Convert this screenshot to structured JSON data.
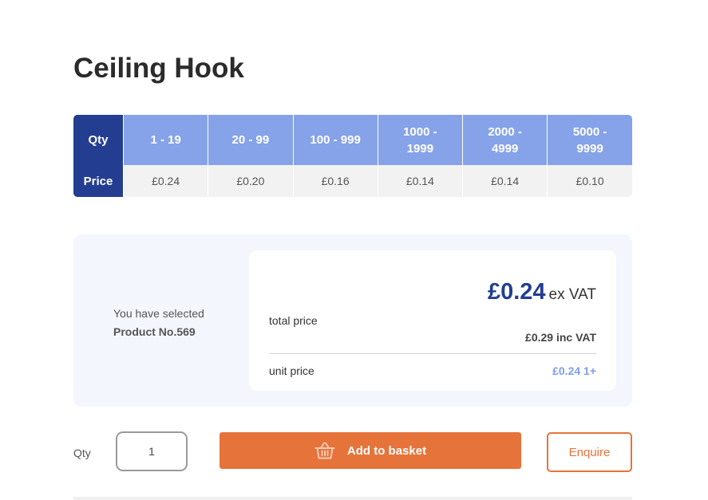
{
  "product": {
    "title": "Ceiling Hook"
  },
  "pricing_table": {
    "qty_header": "Qty",
    "price_header": "Price",
    "tiers": [
      {
        "qty": "1 - 19",
        "price": "£0.24"
      },
      {
        "qty": "20 - 99",
        "price": "£0.20"
      },
      {
        "qty": "100 - 999",
        "price": "£0.16"
      },
      {
        "qty": "1000 - 1999",
        "price": "£0.14"
      },
      {
        "qty": "2000 - 4999",
        "price": "£0.14"
      },
      {
        "qty": "5000 - 9999",
        "price": "£0.10"
      }
    ]
  },
  "summary": {
    "selected_line1": "You have selected",
    "selected_line2": "Product No.569",
    "total_price_label": "total price",
    "total_price_value": "£0.24",
    "ex_vat_label": "ex VAT",
    "inc_vat_text": "£0.29 inc VAT",
    "unit_price_label": "unit price",
    "unit_price_value": "£0.24 1+"
  },
  "actions": {
    "qty_label": "Qty",
    "qty_value": "1",
    "add_to_basket_label": "Add to basket",
    "enquire_label": "Enquire",
    "basket_icon": "basket-icon"
  },
  "colors": {
    "brand_dark_blue": "#233e91",
    "tier_blue": "#86a3e9",
    "accent_orange": "#e6733a",
    "unit_price_blue": "#7f9de8"
  }
}
